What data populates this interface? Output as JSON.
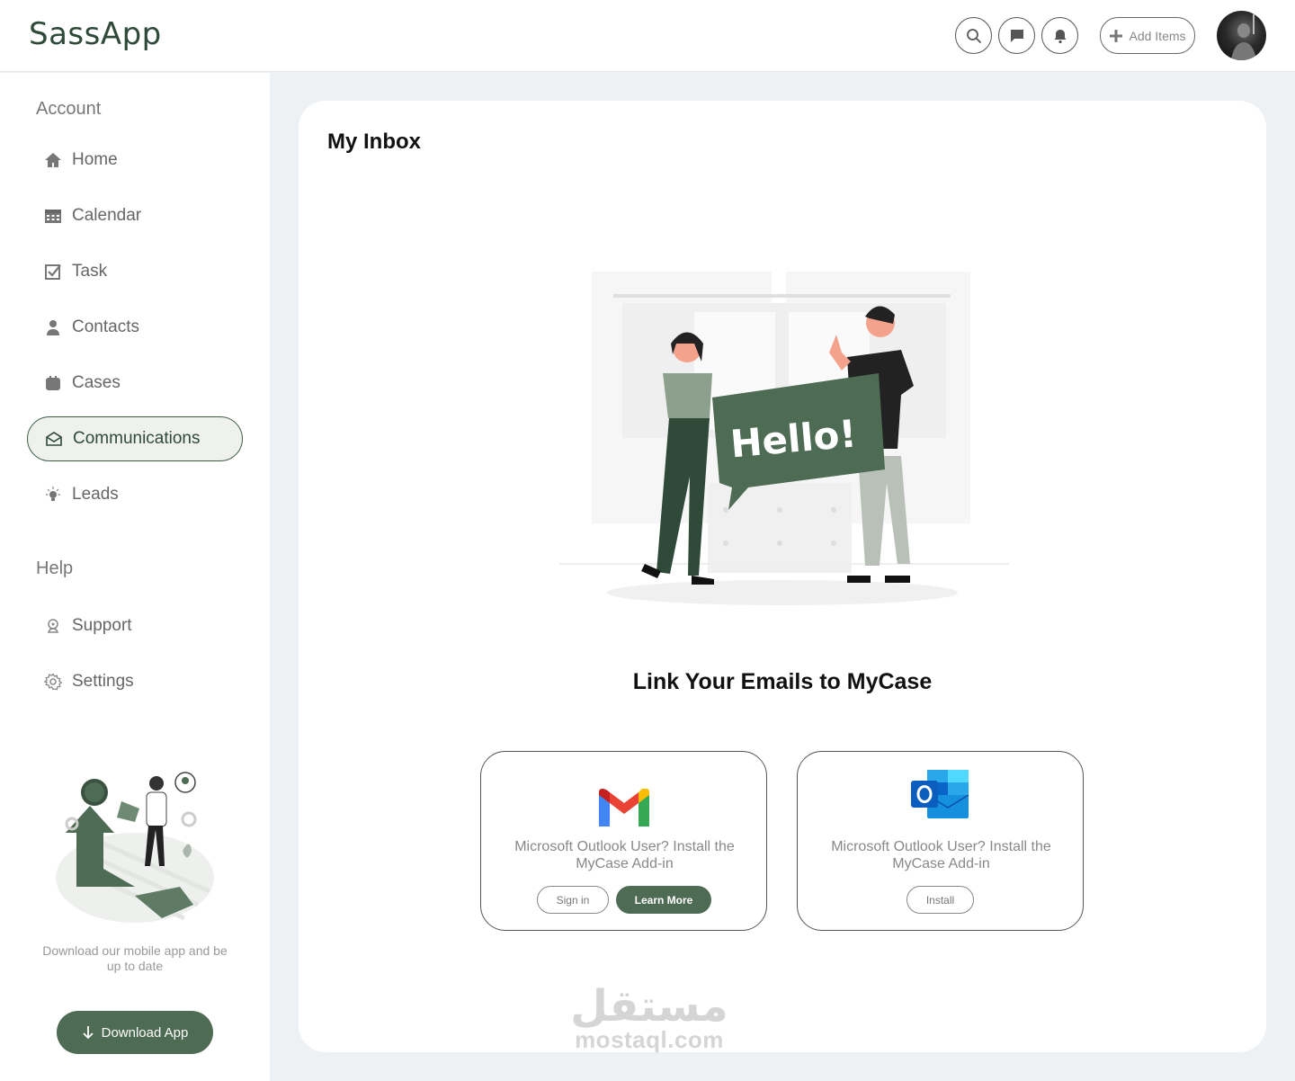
{
  "app": {
    "logo": "SassApp"
  },
  "header": {
    "add_items_label": "Add Items"
  },
  "sidebar": {
    "account_title": "Account",
    "help_title": "Help",
    "items": [
      {
        "label": "Home",
        "icon": "home-icon"
      },
      {
        "label": "Calendar",
        "icon": "calendar-icon"
      },
      {
        "label": "Task",
        "icon": "task-icon"
      },
      {
        "label": "Contacts",
        "icon": "person-icon"
      },
      {
        "label": "Cases",
        "icon": "briefcase-icon"
      },
      {
        "label": "Communications",
        "icon": "envelope-open-icon",
        "active": true
      },
      {
        "label": "Leads",
        "icon": "lightbulb-icon"
      }
    ],
    "help_items": [
      {
        "label": "Support",
        "icon": "support-icon"
      },
      {
        "label": "Settings",
        "icon": "gear-icon"
      }
    ],
    "promo_text": "Download our mobile app and be up to date",
    "download_label": "Download App"
  },
  "main": {
    "title": "My Inbox",
    "illustration_text": "Hello!",
    "link_title": "Link Your Emails to MyCase",
    "providers": [
      {
        "name": "gmail",
        "description": "Microsoft Outlook User? Install the MyCase Add-in",
        "buttons": [
          "Sign in",
          "Learn More"
        ]
      },
      {
        "name": "outlook",
        "description": "Microsoft Outlook User? Install the MyCase Add-in",
        "buttons": [
          "Install"
        ]
      }
    ],
    "watermark_ar": "مستقل",
    "watermark_en": "mostaql.com"
  },
  "colors": {
    "accent": "#4e6b53",
    "background": "#eef1f4"
  }
}
